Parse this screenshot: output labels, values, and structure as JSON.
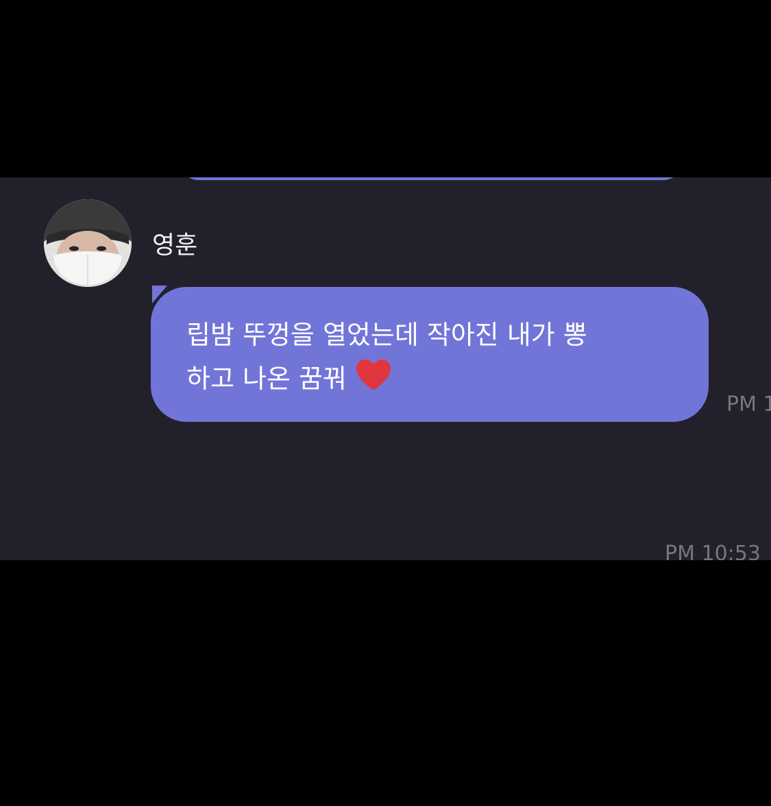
{
  "chat": {
    "sender": {
      "name": "영훈"
    },
    "message": {
      "line1": "립밤 뚜껑을 열었는데 작아진 내가 뽕",
      "line2": "하고 나온 꿈꿔",
      "emoji": "heart-icon",
      "time_partial": "PM 1"
    },
    "next_message": {
      "time": "PM 10:53"
    },
    "colors": {
      "background": "#000000",
      "chat_bg": "#22212b",
      "bubble": "#7275d8",
      "text": "#ffffff",
      "timestamp": "#77767f",
      "heart": "#e0373f"
    }
  }
}
